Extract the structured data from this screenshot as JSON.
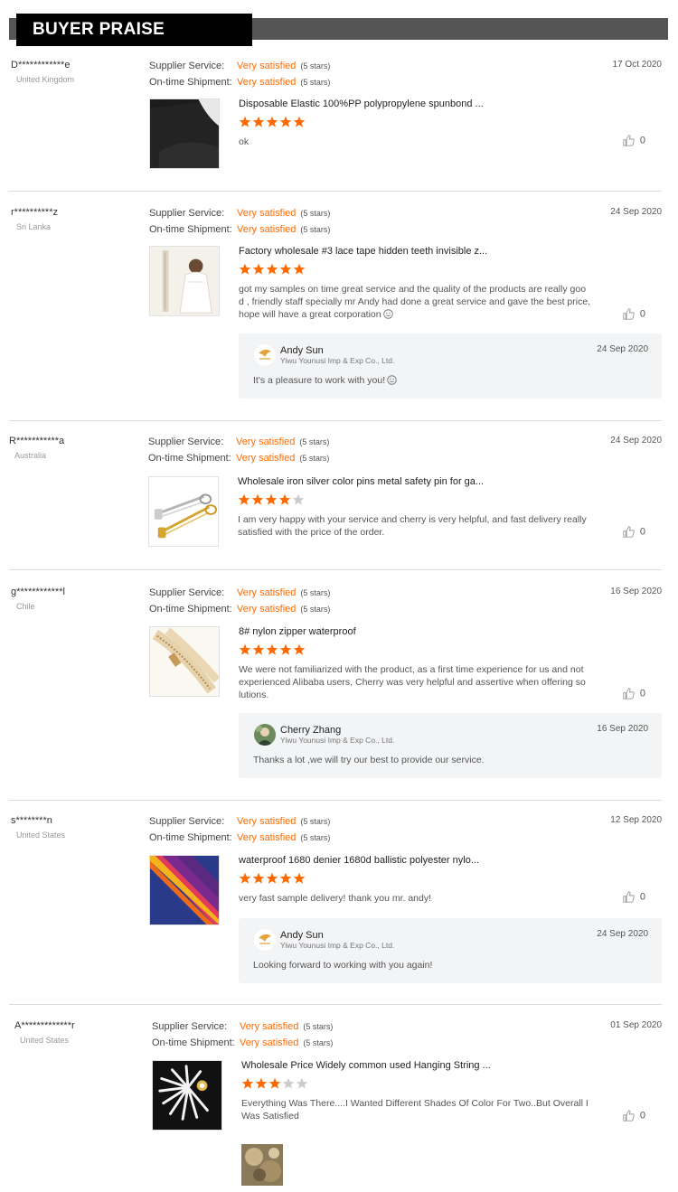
{
  "header": {
    "title": "BUYER PRAISE"
  },
  "labels": {
    "supplier_service": "Supplier Service:",
    "ontime_shipment": "On-time Shipment:"
  },
  "reviews": [
    {
      "name": "D************e",
      "country": "United Kingdom",
      "date": "17 Oct 2020",
      "supplier_service": "Very satisfied",
      "supplier_stars": "(5 stars)",
      "ontime": "Very satisfied",
      "ontime_stars": "(5 stars)",
      "product_title": "Disposable Elastic 100%PP polypropylene spunbond ...",
      "rating": 5,
      "comment": "ok",
      "likes": "0"
    },
    {
      "name": "r**********z",
      "country": "Sri Lanka",
      "date": "24 Sep 2020",
      "supplier_service": "Very satisfied",
      "supplier_stars": "(5 stars)",
      "ontime": "Very satisfied",
      "ontime_stars": "(5 stars)",
      "product_title": "Factory wholesale #3 lace tape hidden teeth invisible z...",
      "rating": 5,
      "comment_lines": [
        "got my samples on time great service and the quality of the products are really goo",
        "d , friendly staff specially mr Andy had done a great service and gave the best price,",
        "hope will  have a great corporation"
      ],
      "likes": "0",
      "reply": {
        "name": "Andy Sun",
        "company": "Yiwu Younusi Imp & Exp Co., Ltd.",
        "date": "24 Sep 2020",
        "text": "It's a pleasure to work with you!"
      }
    },
    {
      "name": "R***********a",
      "country": "Australia",
      "date": "24 Sep 2020",
      "supplier_service": "Very satisfied",
      "supplier_stars": "(5 stars)",
      "ontime": "Very satisfied",
      "ontime_stars": "(5 stars)",
      "product_title": "Wholesale iron silver color pins metal safety pin for ga...",
      "rating": 4,
      "comment_lines": [
        "I am very happy with your service and cherry is very helpful, and fast delivery really",
        "satisfied with the price of the order."
      ],
      "likes": "0"
    },
    {
      "name": "g************l",
      "country": "Chile",
      "date": "16 Sep 2020",
      "supplier_service": "Very satisfied",
      "supplier_stars": "(5 stars)",
      "ontime": "Very satisfied",
      "ontime_stars": "(5 stars)",
      "product_title": "8# nylon zipper waterproof",
      "rating": 5,
      "comment_lines": [
        "We were not familiarized with the product, as a first time experience for us and not",
        "experienced Alibaba users, Cherry was very helpful and assertive when offering so",
        "lutions."
      ],
      "likes": "0",
      "reply": {
        "name": "Cherry Zhang",
        "company": "Yiwu Younusi Imp & Exp Co., Ltd.",
        "date": "16 Sep 2020",
        "text": "Thanks a lot ,we will try our best to provide our service."
      }
    },
    {
      "name": "s********n",
      "country": "United States",
      "date": "12 Sep 2020",
      "supplier_service": "Very satisfied",
      "supplier_stars": "(5 stars)",
      "ontime": "Very satisfied",
      "ontime_stars": "(5 stars)",
      "product_title": "waterproof 1680 denier 1680d ballistic polyester nylo...",
      "rating": 5,
      "comment": "very fast sample delivery! thank you mr. andy!",
      "likes": "0",
      "reply": {
        "name": "Andy Sun",
        "company": "Yiwu Younusi Imp & Exp Co., Ltd.",
        "date": "24 Sep 2020",
        "text": "Looking forward to working with you again!"
      }
    },
    {
      "name": "A*************r",
      "country": "United States",
      "date": "01 Sep 2020",
      "supplier_service": "Very satisfied",
      "supplier_stars": "(5 stars)",
      "ontime": "Very satisfied",
      "ontime_stars": "(5 stars)",
      "product_title": "Wholesale Price Widely common used Hanging String ...",
      "rating": 3,
      "comment_lines": [
        "Everything Was There....I Wanted Different Shades Of Color For Two..But Overall I",
        "Was Satisfied"
      ],
      "likes": "0"
    }
  ],
  "icons": {
    "star": "star-icon",
    "like": "thumbs-up-icon",
    "smile": "smile-icon"
  },
  "colors": {
    "accent": "#ff6a00",
    "star_empty": "#cccccc",
    "reply_bg": "#f3f4f6"
  }
}
